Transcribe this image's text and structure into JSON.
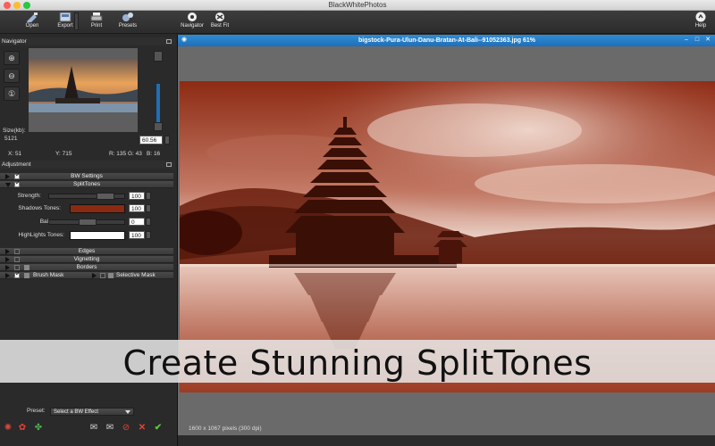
{
  "window": {
    "title": "BlackWhitePhotos"
  },
  "toolbar": {
    "open": "Open",
    "export": "Export",
    "print": "Print",
    "presets": "Presets",
    "navigator": "Navigator",
    "best_fit": "Best Fit",
    "help": "Help"
  },
  "navigator": {
    "title": "Navigator",
    "size_label": "Size(kb):",
    "size_value": "5121",
    "zoom_value": "60.56",
    "x": "X: 51",
    "y": "Y: 715",
    "r": "R: 135",
    "g": "G: 43",
    "b": "B: 16"
  },
  "adjustment": {
    "title": "Adjustment",
    "groups": {
      "bw_settings": "BW Settings",
      "splittones": "SplitTones",
      "edges": "Edges",
      "vignetting": "Vignetting",
      "borders": "Borders",
      "brush_mask": "Brush Mask",
      "selective_mask": "Selective Mask"
    },
    "controls": {
      "strength_label": "Strength:",
      "strength_value": "100",
      "strength_level": 0.8,
      "shadows_label": "Shadows Tones:",
      "shadows_value": "100",
      "shadows_color": "#8a2a12",
      "balance_label": "Balance:",
      "balance_value": "0",
      "balance_level": 0.5,
      "highlights_label": "HighLights Tones:",
      "highlights_value": "100",
      "highlights_color": "#ffffff"
    }
  },
  "preset": {
    "label": "Preset:",
    "value": "Select a BW Effect"
  },
  "document": {
    "title": "bigstock-Pura-Ulun-Danu-Bratan-At-Bali--91052363.jpg 61%",
    "status": "1600 x 1067 pixels (300 dpi)"
  },
  "banner": {
    "text": "Create Stunning SplitTones"
  },
  "colors": {
    "accent": "#1e6fb8",
    "tone": "#8a2a12"
  }
}
